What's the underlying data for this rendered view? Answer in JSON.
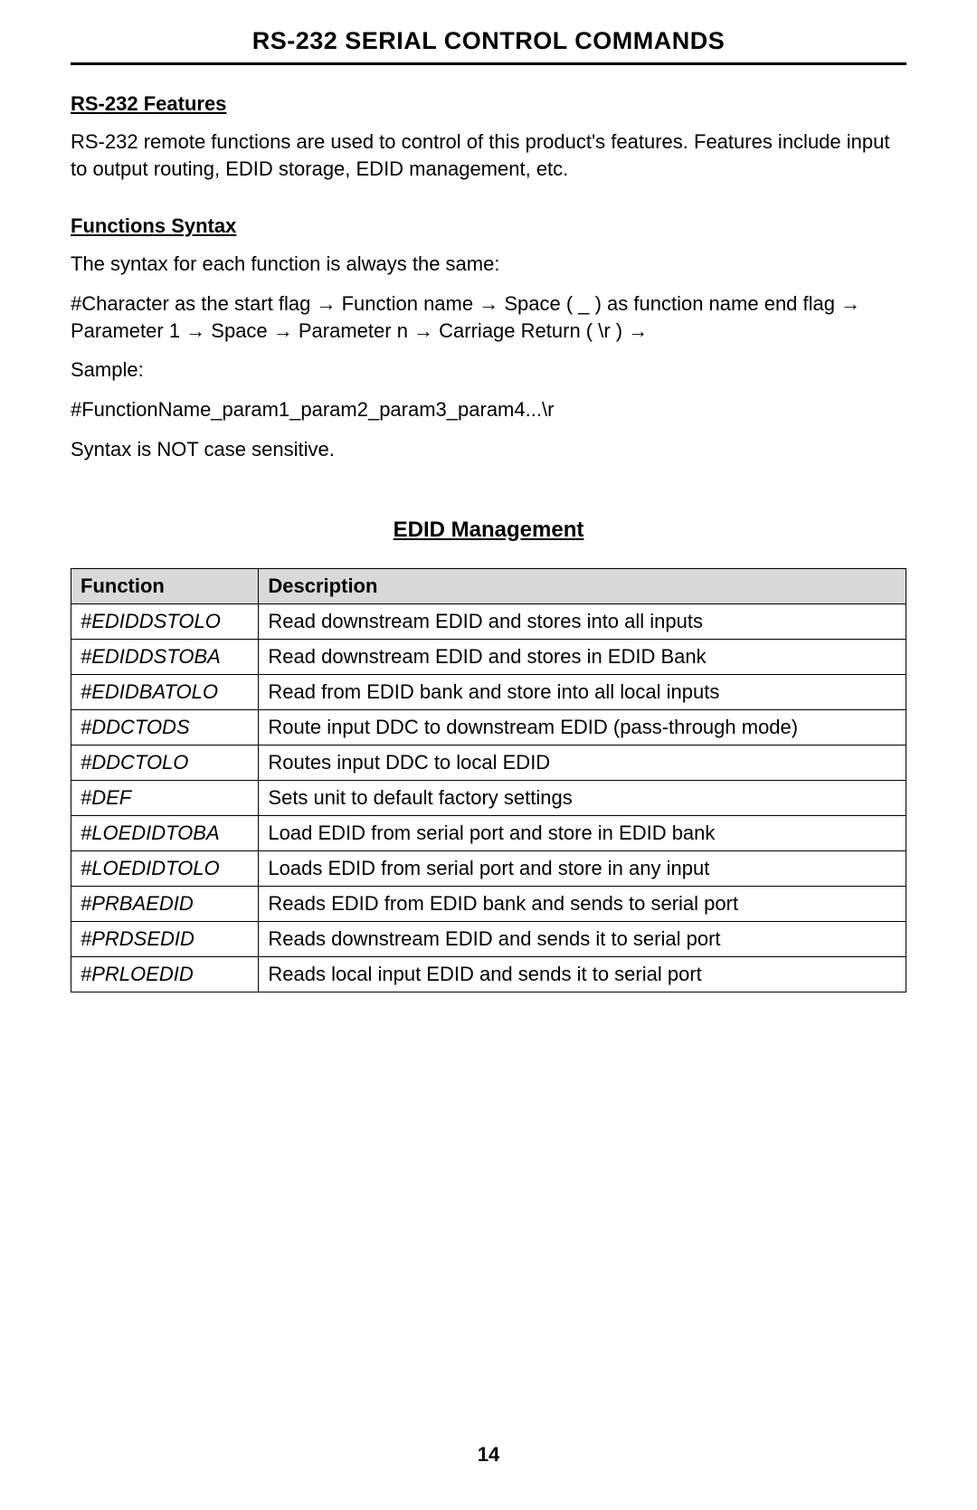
{
  "title": "RS-232 SERIAL CONTROL COMMANDS",
  "features": {
    "heading": "RS-232 Features",
    "text": "RS-232 remote functions are used to control of this product's features. Features include input to output routing, EDID storage, EDID management, etc."
  },
  "syntax": {
    "heading": "Functions Syntax",
    "intro": "The syntax for each function is always the same:",
    "detail": "#Character as the start flag → Function name → Space ( _ ) as function name end flag → Parameter 1 → Space → Parameter n → Carriage Return ( \\r ) →",
    "sample_label": "Sample:",
    "sample": "#FunctionName_param1_param2_param3_param4...\\r",
    "note": "Syntax is NOT case sensitive."
  },
  "edid": {
    "heading": "EDID Management",
    "col_function": "Function",
    "col_description": "Description",
    "rows": [
      {
        "fn": "#EDIDDSTOLO",
        "desc": "Read downstream EDID and stores into all inputs"
      },
      {
        "fn": "#EDIDDSTOBA",
        "desc": "Read downstream EDID and stores in EDID Bank"
      },
      {
        "fn": "#EDIDBATOLO",
        "desc": "Read from EDID bank and store into all local inputs"
      },
      {
        "fn": "#DDCTODS",
        "desc": "Route input DDC to downstream EDID (pass-through mode)"
      },
      {
        "fn": "#DDCTOLO",
        "desc": "Routes input DDC to local EDID"
      },
      {
        "fn": "#DEF",
        "desc": "Sets unit to default factory settings"
      },
      {
        "fn": "#LOEDIDTOBA",
        "desc": "Load EDID from serial port and store in EDID bank"
      },
      {
        "fn": "#LOEDIDTOLO",
        "desc": "Loads EDID from serial port and store in any input"
      },
      {
        "fn": "#PRBAEDID",
        "desc": "Reads EDID from EDID bank and sends to serial port"
      },
      {
        "fn": "#PRDSEDID",
        "desc": "Reads downstream EDID and sends it to serial port"
      },
      {
        "fn": "#PRLOEDID",
        "desc": "Reads local input EDID and sends it to serial port"
      }
    ]
  },
  "page_number": "14"
}
